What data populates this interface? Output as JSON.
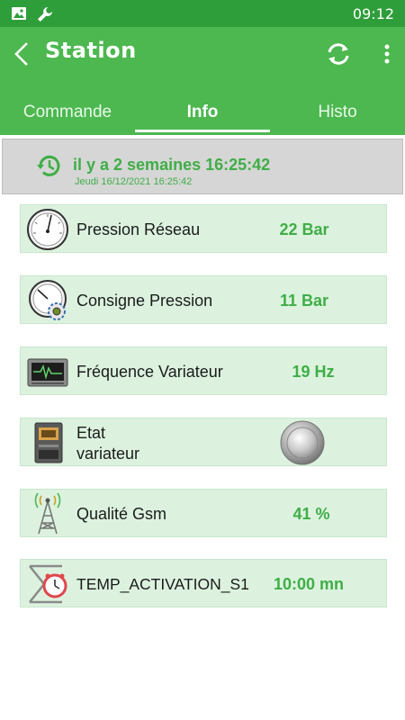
{
  "status_bar": {
    "time": "09:12"
  },
  "app_bar": {
    "title": "Station"
  },
  "tabs": [
    {
      "label": "Commande",
      "active": false
    },
    {
      "label": "Info",
      "active": true
    },
    {
      "label": "Histo",
      "active": false
    }
  ],
  "last_update": {
    "relative": "il y a 2 semaines 16:25:42",
    "absolute": "Jeudi 16/12/2021 16:25:42"
  },
  "rows": [
    {
      "label": "Pression Réseau",
      "value": "22 Bar",
      "icon": "pressure-gauge-icon"
    },
    {
      "label": "Consigne Pression",
      "value": "11 Bar",
      "icon": "pressure-setpoint-gauge-icon"
    },
    {
      "label": "Fréquence Variateur",
      "value": "19 Hz",
      "icon": "oscilloscope-icon"
    },
    {
      "label_line1": "Etat",
      "label_line2": "variateur",
      "icon": "variable-drive-icon",
      "status_icon": "status-led-icon"
    },
    {
      "label": "Qualité Gsm",
      "value": "41 %",
      "icon": "antenna-tower-icon"
    },
    {
      "label": "TEMP_ACTIVATION_S1",
      "value": "10:00 mn",
      "icon": "timer-clock-icon"
    }
  ],
  "colors": {
    "primary": "#4cb84f",
    "status_bar": "#2e9e3a",
    "accent_text": "#3fae46",
    "row_bg": "#dcf2df"
  }
}
